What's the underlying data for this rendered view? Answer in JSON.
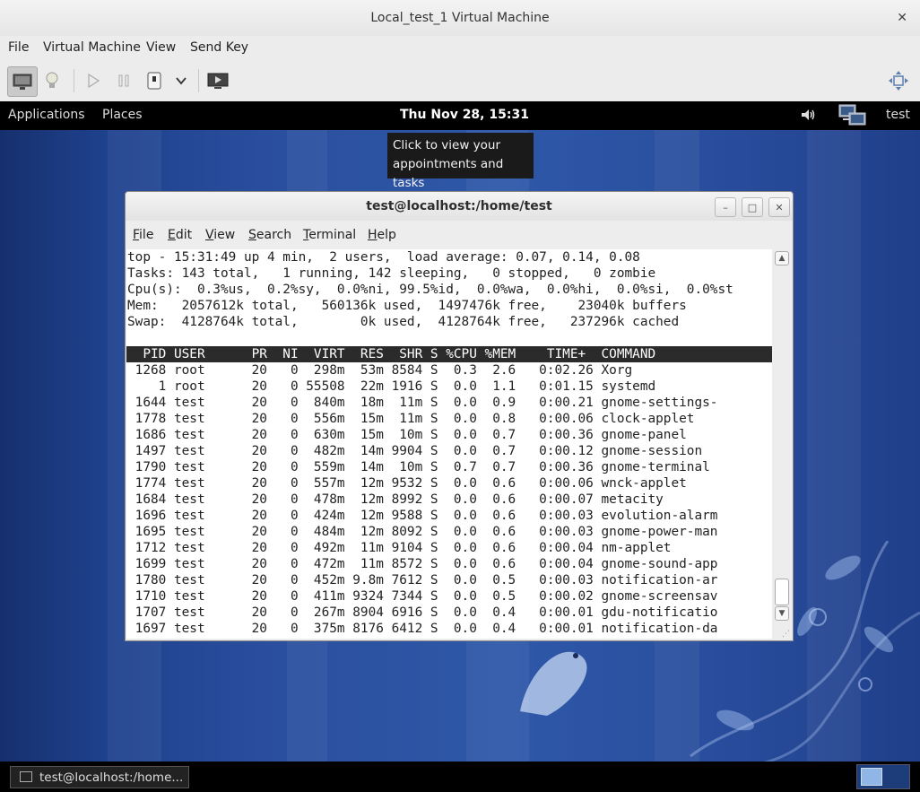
{
  "vm": {
    "title": "Local_test_1 Virtual Machine",
    "close_glyph": "✕",
    "menu": [
      "File",
      "Virtual Machine",
      "View",
      "Send Key"
    ],
    "toolbar": {
      "icons": [
        "display-icon",
        "lightbulb-icon",
        "play-icon",
        "pause-icon",
        "power-icon",
        "chevron-down-icon",
        "screenshot-icon",
        "fullscreen-icon"
      ]
    }
  },
  "guest": {
    "topbar": {
      "applications": "Applications",
      "places": "Places",
      "clock": "Thu Nov 28, 15:31",
      "user": "test"
    },
    "tooltip": {
      "line1": "Click to view your",
      "line2": "appointments and tasks"
    },
    "taskbar": {
      "window_button": "test@localhost:/home..."
    }
  },
  "terminal": {
    "title": "test@localhost:/home/test",
    "menu": [
      {
        "label": "File",
        "underline": "F",
        "rest": "ile"
      },
      {
        "label": "Edit",
        "underline": "E",
        "rest": "dit"
      },
      {
        "label": "View",
        "underline": "V",
        "rest": "iew"
      },
      {
        "label": "Search",
        "underline": "S",
        "rest": "earch"
      },
      {
        "label": "Terminal",
        "underline": "T",
        "rest": "erminal"
      },
      {
        "label": "Help",
        "underline": "H",
        "rest": "elp"
      }
    ],
    "summary": [
      "top - 15:31:49 up 4 min,  2 users,  load average: 0.07, 0.14, 0.08",
      "Tasks: 143 total,   1 running, 142 sleeping,   0 stopped,   0 zombie",
      "Cpu(s):  0.3%us,  0.2%sy,  0.0%ni, 99.5%id,  0.0%wa,  0.0%hi,  0.0%si,  0.0%st",
      "Mem:   2057612k total,   560136k used,  1497476k free,    23040k buffers",
      "Swap:  4128764k total,        0k used,  4128764k free,   237296k cached",
      ""
    ],
    "header": "  PID USER      PR  NI  VIRT  RES  SHR S %CPU %MEM    TIME+  COMMAND           ",
    "processes": [
      " 1268 root      20   0  298m  53m 8584 S  0.3  2.6   0:02.26 Xorg",
      "    1 root      20   0 55508  22m 1916 S  0.0  1.1   0:01.15 systemd",
      " 1644 test      20   0  840m  18m  11m S  0.0  0.9   0:00.21 gnome-settings-",
      " 1778 test      20   0  556m  15m  11m S  0.0  0.8   0:00.06 clock-applet",
      " 1686 test      20   0  630m  15m  10m S  0.0  0.7   0:00.36 gnome-panel",
      " 1497 test      20   0  482m  14m 9904 S  0.0  0.7   0:00.12 gnome-session",
      " 1790 test      20   0  559m  14m  10m S  0.7  0.7   0:00.36 gnome-terminal",
      " 1774 test      20   0  557m  12m 9532 S  0.0  0.6   0:00.06 wnck-applet",
      " 1684 test      20   0  478m  12m 8992 S  0.0  0.6   0:00.07 metacity",
      " 1696 test      20   0  424m  12m 9588 S  0.0  0.6   0:00.03 evolution-alarm",
      " 1695 test      20   0  484m  12m 8092 S  0.0  0.6   0:00.03 gnome-power-man",
      " 1712 test      20   0  492m  11m 9104 S  0.0  0.6   0:00.04 nm-applet",
      " 1699 test      20   0  472m  11m 8572 S  0.0  0.6   0:00.04 gnome-sound-app",
      " 1780 test      20   0  452m 9.8m 7612 S  0.0  0.5   0:00.03 notification-ar",
      " 1710 test      20   0  411m 9324 7344 S  0.0  0.5   0:00.02 gnome-screensav",
      " 1707 test      20   0  267m 8904 6916 S  0.0  0.4   0:00.01 gdu-notificatio",
      " 1697 test      20   0  375m 8176 6412 S  0.0  0.4   0:00.01 notification-da"
    ]
  }
}
